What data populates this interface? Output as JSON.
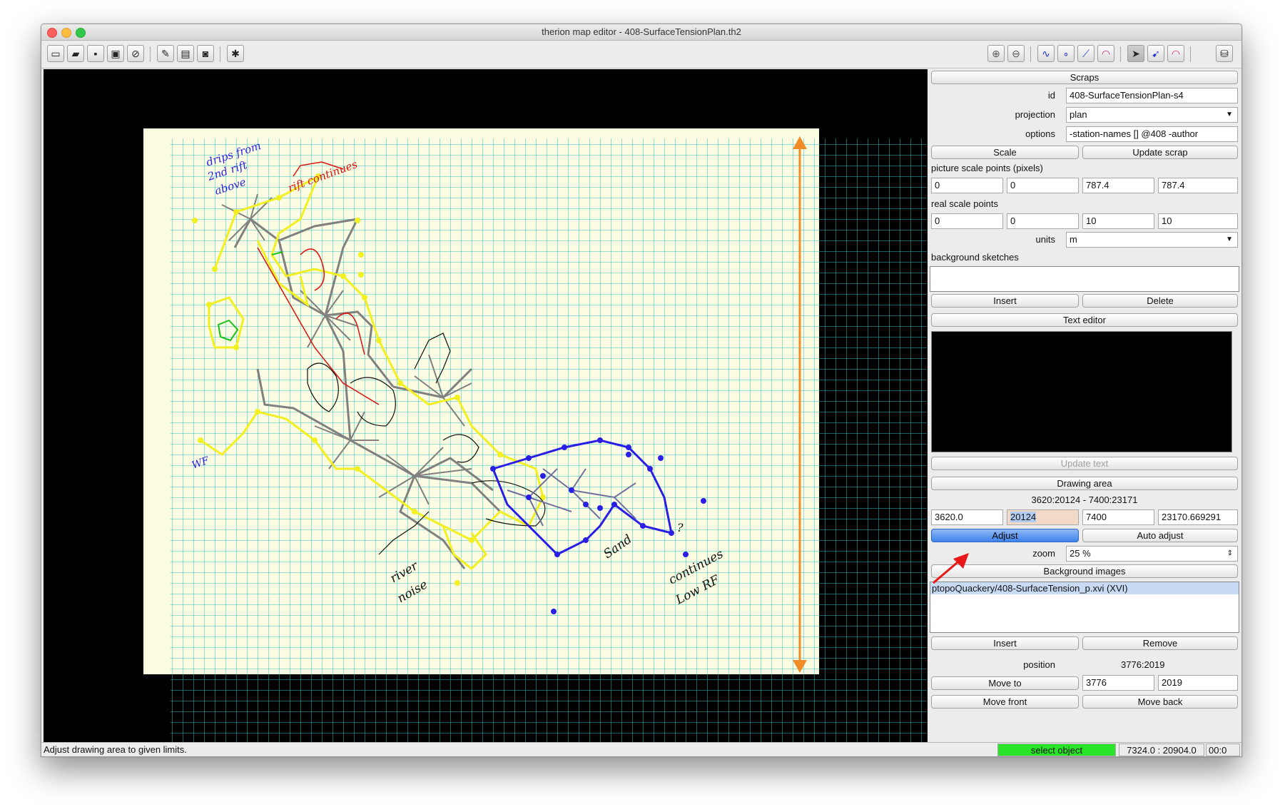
{
  "window": {
    "title": "therion map editor - 408-SurfaceTensionPlan.th2"
  },
  "toolbar": {
    "left": [
      "new-file-icon",
      "open-file-icon",
      "save-icon",
      "save-as-icon",
      "close-file-icon",
      "edit-icon",
      "layers-icon",
      "view-icon",
      "settings-icon"
    ],
    "right": [
      "zoom-in-icon",
      "zoom-out-icon",
      "insert-line-icon",
      "insert-point-icon",
      "insert-line-point-icon",
      "insert-area-icon",
      "select-object-icon",
      "select-line-icon",
      "select-area-icon",
      "trash-icon"
    ]
  },
  "panel": {
    "scraps_header": "Scraps",
    "id_label": "id",
    "id_value": "408-SurfaceTensionPlan-s4",
    "projection_label": "projection",
    "projection_value": "plan",
    "options_label": "options",
    "options_value": "-station-names [] @408 -author",
    "scale_button": "Scale",
    "update_scrap_button": "Update scrap",
    "picture_scale_label": "picture scale points (pixels)",
    "picture_scale": [
      "0",
      "0",
      "787.4",
      "787.4"
    ],
    "real_scale_label": "real scale points",
    "real_scale": [
      "0",
      "0",
      "10",
      "10"
    ],
    "units_label": "units",
    "units_value": "m",
    "background_sketches_label": "background sketches",
    "insert_button": "Insert",
    "delete_button": "Delete",
    "text_editor_header": "Text editor",
    "update_text_button": "Update text",
    "drawing_area_header": "Drawing area",
    "drawing_area_range": "3620:20124 - 7400:23171",
    "drawing_area_fields": [
      "3620.0",
      "20124",
      "7400",
      "23170.669291"
    ],
    "adjust_button": "Adjust",
    "auto_adjust_button": "Auto adjust",
    "zoom_label": "zoom",
    "zoom_value": "25 %",
    "background_images_header": "Background images",
    "background_image_item": "ptopoQuackery/408-SurfaceTension_p.xvi (XVI)",
    "insert_image_button": "Insert",
    "remove_image_button": "Remove",
    "position_label": "position",
    "position_value": "3776:2019",
    "move_to_button": "Move to",
    "move_to_x": "3776",
    "move_to_y": "2019",
    "move_front_button": "Move front",
    "move_back_button": "Move back"
  },
  "sketch_text": {
    "drips": "drips from",
    "drips2": "2nd rift",
    "drips3": "above",
    "rift": "rift continues",
    "river": "river",
    "noise": "noise",
    "sand": "Sand",
    "continues": "continues",
    "lowrf": "Low RF",
    "q": "?",
    "wf": "WF"
  },
  "status": {
    "message": "Adjust drawing area to given limits.",
    "mode": "select object",
    "coords": "7324.0 : 20904.0",
    "time": "00:0"
  },
  "colors": {
    "grid": "#2fc0c0",
    "paper": "#fcfce2",
    "yellow": "#f2f020",
    "blue": "#2a1ee6",
    "orange": "#f08c28",
    "mode": "#29e428"
  }
}
